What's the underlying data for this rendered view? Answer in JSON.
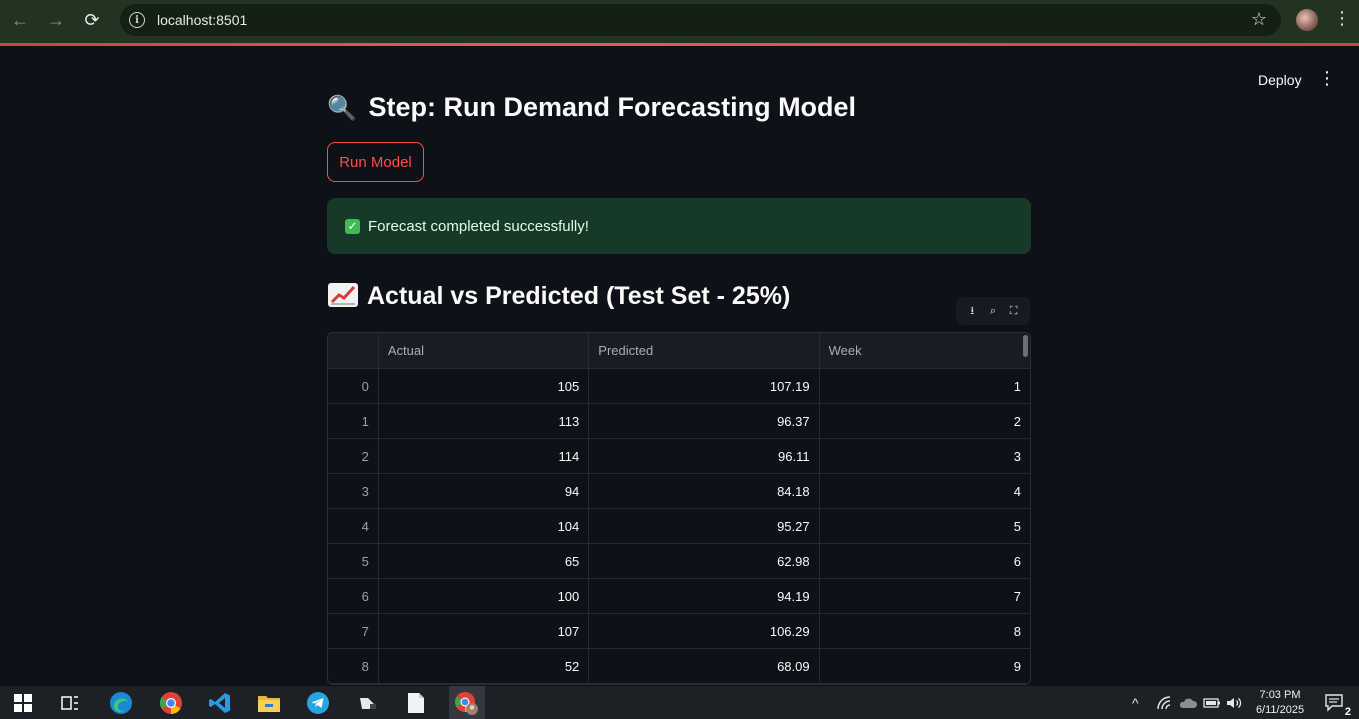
{
  "browser": {
    "url": "localhost:8501",
    "nav_back": "←",
    "nav_forward": "→",
    "reload": "⟳",
    "star": "☆",
    "menu": "⋮"
  },
  "app": {
    "deploy_label": "Deploy",
    "menu_label": "⋮",
    "step_heading": "Step: Run Demand Forecasting Model",
    "step_emoji": "🔍",
    "run_button": "Run Model",
    "success_message": "Forecast completed successfully!",
    "success_check": "✓",
    "results_heading": "Actual vs Predicted (Test Set - 25%)",
    "accent_color": "#ff4b4b",
    "success_bg": "#173928"
  },
  "toolbar": {
    "download": "⭳",
    "search": "⌕",
    "fullscreen": "⛶"
  },
  "table": {
    "columns": [
      "",
      "Actual",
      "Predicted",
      "Week"
    ],
    "rows": [
      [
        "0",
        "105",
        "107.19",
        "1"
      ],
      [
        "1",
        "113",
        "96.37",
        "2"
      ],
      [
        "2",
        "114",
        "96.11",
        "3"
      ],
      [
        "3",
        "94",
        "84.18",
        "4"
      ],
      [
        "4",
        "104",
        "95.27",
        "5"
      ],
      [
        "5",
        "65",
        "62.98",
        "6"
      ],
      [
        "6",
        "100",
        "94.19",
        "7"
      ],
      [
        "7",
        "107",
        "106.29",
        "8"
      ],
      [
        "8",
        "52",
        "68.09",
        "9"
      ]
    ]
  },
  "taskbar": {
    "time": "7:03 PM",
    "date": "6/11/2025",
    "notification_count": "2",
    "tray_chevron": "^"
  }
}
